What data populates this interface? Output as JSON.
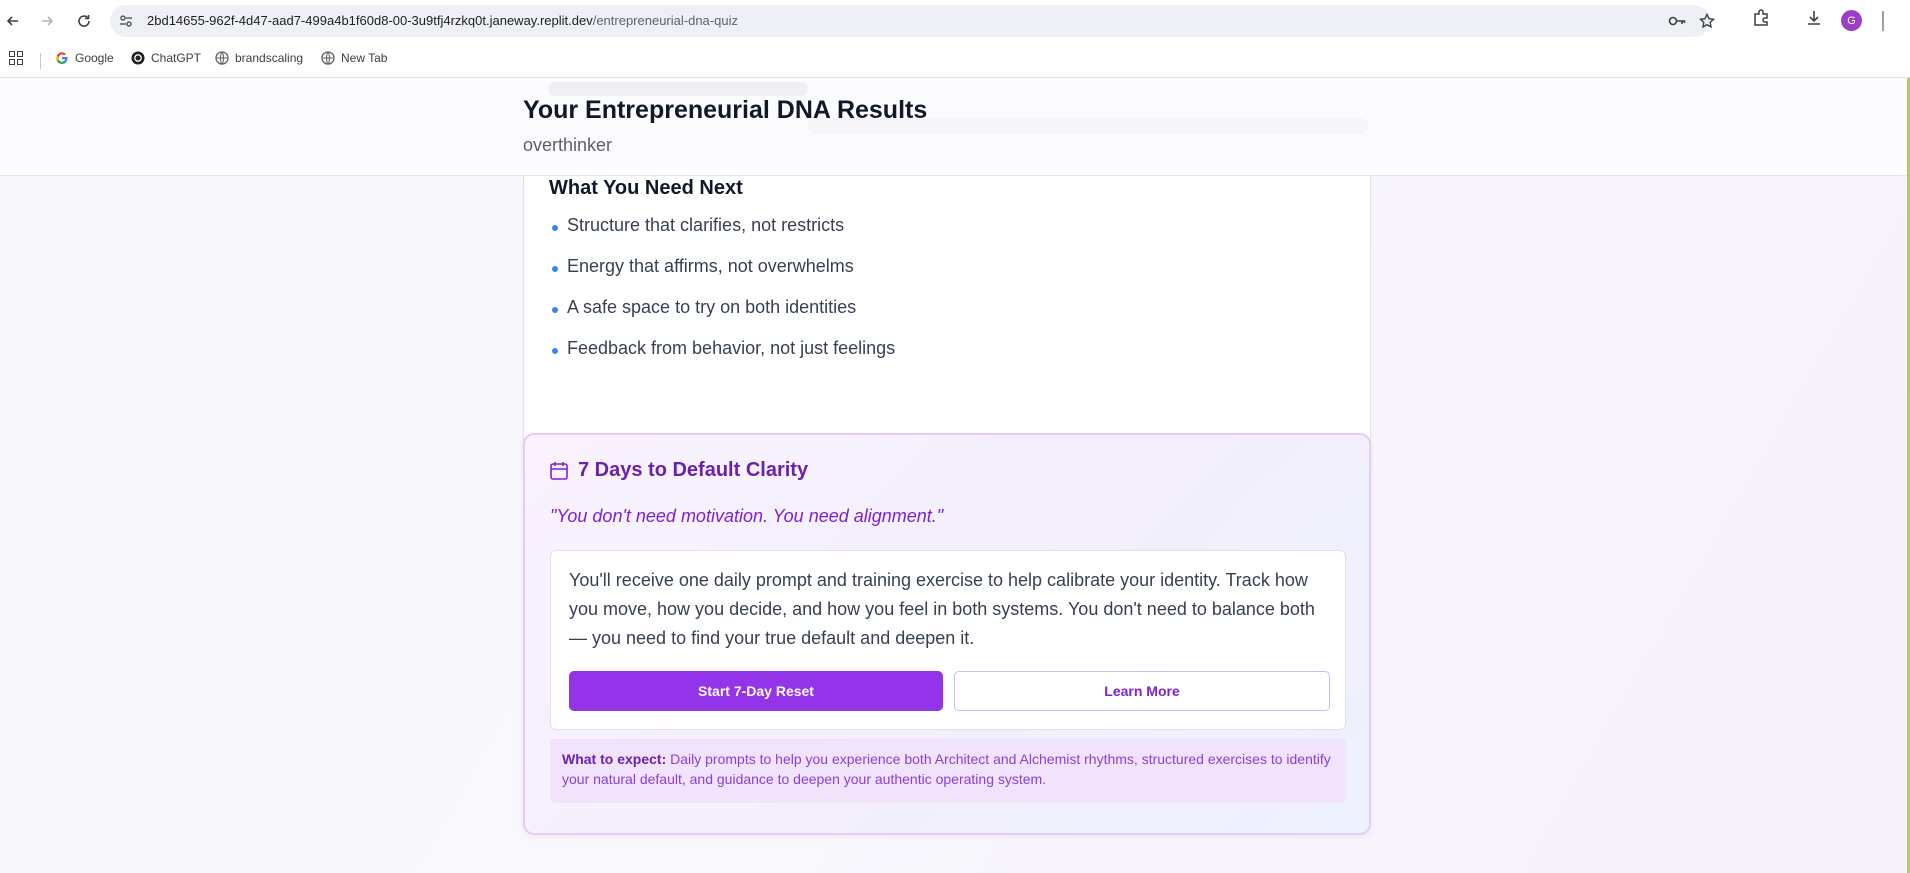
{
  "browser": {
    "url_host": "2bd14655-962f-4d47-aad7-499a4b1f60d8-00-3u9tfj4rzkq0t.janeway.replit.dev",
    "url_path": "/entrepreneurial-dna-quiz",
    "avatar_letter": "G",
    "bookmarks": [
      {
        "label": "Google",
        "icon": "google-icon"
      },
      {
        "label": "ChatGPT",
        "icon": "chatgpt-icon"
      },
      {
        "label": "brandscaling",
        "icon": "globe-icon"
      },
      {
        "label": "New Tab",
        "icon": "globe-icon"
      }
    ]
  },
  "header": {
    "title": "Your Entrepreneurial DNA Results",
    "subtitle": "overthinker"
  },
  "needs": {
    "title": "What You Need Next",
    "items": [
      "Structure that clarifies, not restricts",
      "Energy that affirms, not overwhelms",
      "A safe space to try on both identities",
      "Feedback from behavior, not just feelings"
    ]
  },
  "clarity": {
    "icon": "calendar-icon",
    "title": "7 Days to Default Clarity",
    "quote": "\"You don't need motivation. You need alignment.\"",
    "description": "You'll receive one daily prompt and training exercise to help calibrate your identity. Track how you move, how you decide, and how you feel in both systems. You don't need to balance both — you need to find your true default and deepen it.",
    "primary_button": "Start 7-Day Reset",
    "secondary_button": "Learn More",
    "expect_label": "What to expect:",
    "expect_text": "Daily prompts to help you experience both Architect and Alchemist rhythms, structured exercises to identify your natural default, and guidance to deepen your authentic operating system."
  },
  "colors": {
    "accent": "#9333ea",
    "title_purple": "#6b21a8",
    "bullet": "#3b82f6"
  }
}
